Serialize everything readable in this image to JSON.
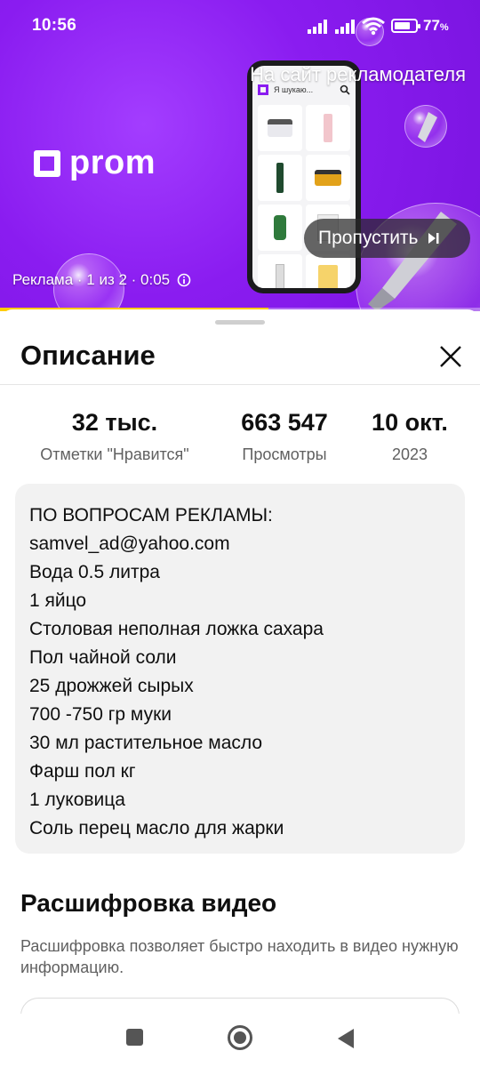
{
  "status_bar": {
    "time": "10:56",
    "battery_percent": "77",
    "battery_unit": "%",
    "battery_level": 0.77
  },
  "ad": {
    "brand": "prom",
    "advertiser_link": "На сайт рекламодателя",
    "skip_label": "Пропустить",
    "meta": "Реклама · 1 из 2 · 0:05",
    "phone_search_text": "Я шукаю...",
    "progress": 0.56,
    "colors": {
      "background": "#8a1cf0",
      "progress": "#ffcc00"
    }
  },
  "sheet": {
    "title": "Описание",
    "stats": {
      "likes": {
        "value": "32 тыс.",
        "label": "Отметки \"Нравится\""
      },
      "views": {
        "value": "663 547",
        "label": "Просмотры"
      },
      "date": {
        "value": "10 окт.",
        "label": "2023"
      }
    },
    "description_lines": [
      "ПО ВОПРОСАМ РЕКЛАМЫ:",
      "samvel_ad@yahoo.com",
      "Вода 0.5 литра",
      "1 яйцо",
      "Столовая неполная ложка сахара",
      "Пол чайной соли",
      "25 дрожжей сырых",
      "700 -750 гр муки",
      "30 мл растительное масло",
      "Фарш пол кг",
      "1 луковица",
      "Соль перец масло для жарки"
    ],
    "transcript": {
      "title": "Расшифровка видео",
      "text": "Расшифровка позволяет быстро находить в видео нужную информацию."
    }
  },
  "icons": {
    "close": "close-icon",
    "skip": "skip-next-icon",
    "info": "info-icon",
    "search": "search-icon"
  }
}
